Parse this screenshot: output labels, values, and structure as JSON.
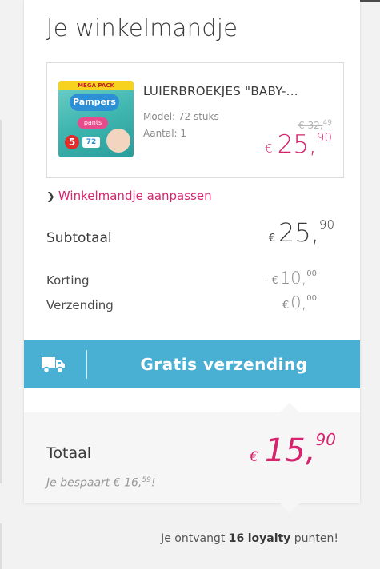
{
  "cart": {
    "title": "Je winkelmandje",
    "product": {
      "name": "LUIERBROEKJES \"BABY-...",
      "model": "Model: 72 stuks",
      "quantity": "Aantal: 1",
      "old_price_int": "32,",
      "old_price_dec": "49",
      "price_currency": "€",
      "price_int": "25,",
      "price_dec": "90",
      "image": {
        "band": "MEGA PACK",
        "brand": "Pampers",
        "line": "pants",
        "size": "5",
        "count": "72"
      }
    },
    "adjust_link": "Winkelmandje aanpassen",
    "subtotal": {
      "label": "Subtotaal",
      "currency": "€",
      "int": "25,",
      "dec": "90"
    },
    "discount": {
      "label": "Korting",
      "currency": "- €",
      "int": "10,",
      "dec": "00"
    },
    "shipping": {
      "label": "Verzending",
      "currency": "€",
      "int": "0,",
      "dec": "00"
    },
    "shipping_banner": {
      "text": "Gratis verzending",
      "icon": "truck-icon"
    },
    "total": {
      "label": "Totaal",
      "currency": "€",
      "int": "15,",
      "dec": "90",
      "savings_prefix": "Je bespaart € 16,",
      "savings_dec": "59",
      "savings_suffix": "!"
    },
    "loyalty": {
      "prefix": "Je ontvangt",
      "points": "16",
      "word": "loyalty",
      "suffix": "punten!"
    }
  },
  "colors": {
    "accent_pink": "#d6246e",
    "banner_blue": "#49afd3"
  }
}
